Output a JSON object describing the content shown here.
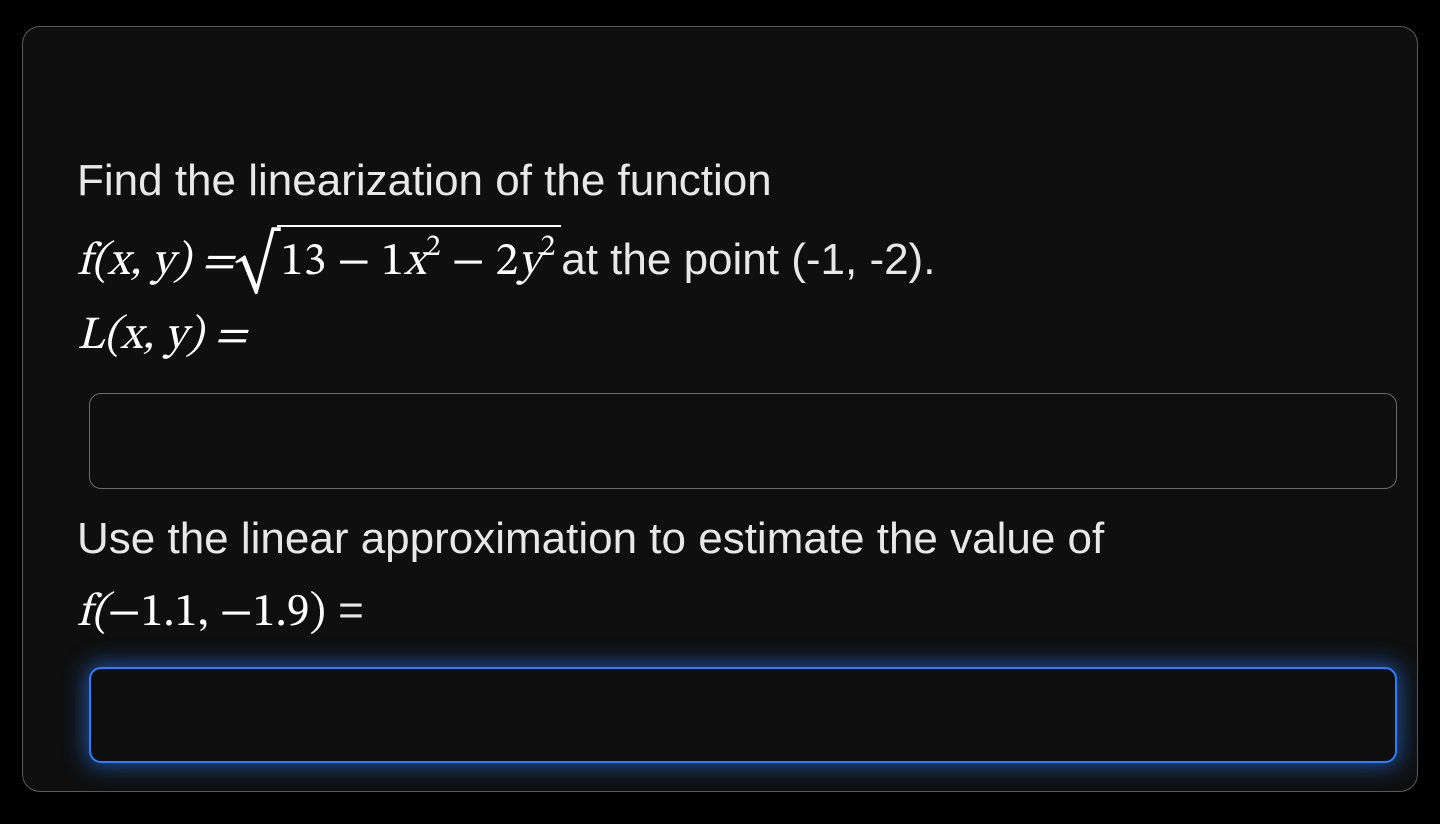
{
  "problem": {
    "intro": "Find the linearization of the function",
    "function_lhs": "f(x, y) = ",
    "sqrt_radicand_parts": {
      "a": "13",
      "minus1": " − ",
      "b_coef": "1",
      "b_var": "x",
      "b_exp": "2",
      "minus2": " − ",
      "c_coef": "2",
      "c_var": "y",
      "c_exp": "2"
    },
    "point_text": " at the point (-1, -2).",
    "linearization_lhs": "L(x, y) = ",
    "input1_value": "",
    "approx_text": "Use the linear approximation to estimate the value of",
    "approx_lhs_f": "f(",
    "approx_args": "−1.1, −1.9",
    "approx_lhs_close": ")",
    "equals": " = ",
    "input2_value": ""
  }
}
